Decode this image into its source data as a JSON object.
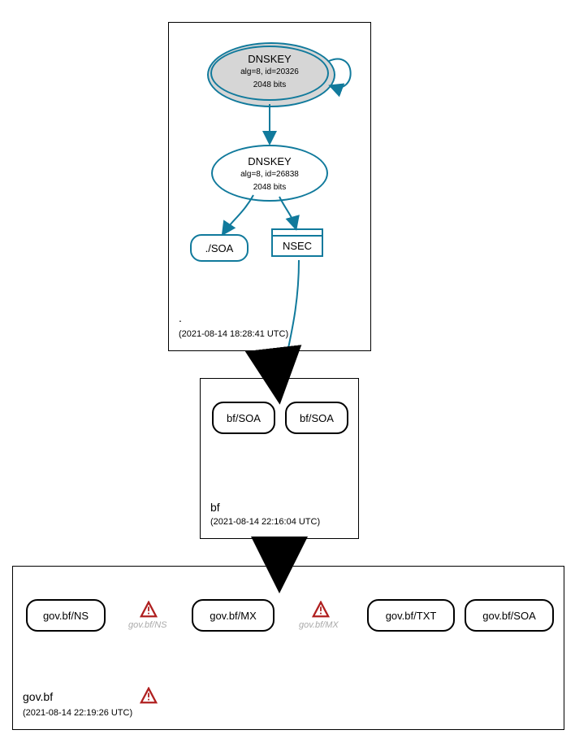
{
  "zones": {
    "root": {
      "label": ".",
      "timestamp": "(2021-08-14 18:28:41 UTC)",
      "ksk": {
        "line1": "DNSKEY",
        "line2": "alg=8, id=20326",
        "line3": "2048 bits"
      },
      "zsk": {
        "line1": "DNSKEY",
        "line2": "alg=8, id=26838",
        "line3": "2048 bits"
      },
      "soa_label": "./SOA",
      "nsec_label": "NSEC"
    },
    "bf": {
      "label": "bf",
      "timestamp": "(2021-08-14 22:16:04 UTC)",
      "soa1": "bf/SOA",
      "soa2": "bf/SOA"
    },
    "govbf": {
      "label": "gov.bf",
      "timestamp": "(2021-08-14 22:19:26 UTC)",
      "ns": "gov.bf/NS",
      "ns_warn_label": "gov.bf/NS",
      "mx": "gov.bf/MX",
      "mx_warn_label": "gov.bf/MX",
      "txt": "gov.bf/TXT",
      "soa": "gov.bf/SOA"
    }
  },
  "chart_data": {
    "type": "diagram",
    "description": "DNSSEC authentication / delegation graph",
    "zones": [
      {
        "name": ".",
        "timestamp_utc": "2021-08-14 18:28:41",
        "keys": [
          {
            "type": "DNSKEY",
            "role": "KSK",
            "algorithm": 8,
            "key_id": 20326,
            "bits": 2048,
            "self_signed": true
          },
          {
            "type": "DNSKEY",
            "role": "ZSK",
            "algorithm": 8,
            "key_id": 26838,
            "bits": 2048
          }
        ],
        "signed_records": [
          "./SOA",
          "NSEC"
        ],
        "edges": [
          {
            "from": "KSK 20326",
            "to": "KSK 20326",
            "kind": "self-loop"
          },
          {
            "from": "KSK 20326",
            "to": "ZSK 26838"
          },
          {
            "from": "ZSK 26838",
            "to": "./SOA"
          },
          {
            "from": "ZSK 26838",
            "to": "NSEC"
          }
        ]
      },
      {
        "name": "bf",
        "timestamp_utc": "2021-08-14 22:16:04",
        "records": [
          "bf/SOA",
          "bf/SOA"
        ],
        "delegation_from": "."
      },
      {
        "name": "gov.bf",
        "timestamp_utc": "2021-08-14 22:19:26",
        "records": [
          "gov.bf/NS",
          "gov.bf/MX",
          "gov.bf/TXT",
          "gov.bf/SOA"
        ],
        "warnings_on": [
          "gov.bf/NS",
          "gov.bf/MX",
          "zone"
        ],
        "delegation_from": "bf"
      }
    ]
  }
}
